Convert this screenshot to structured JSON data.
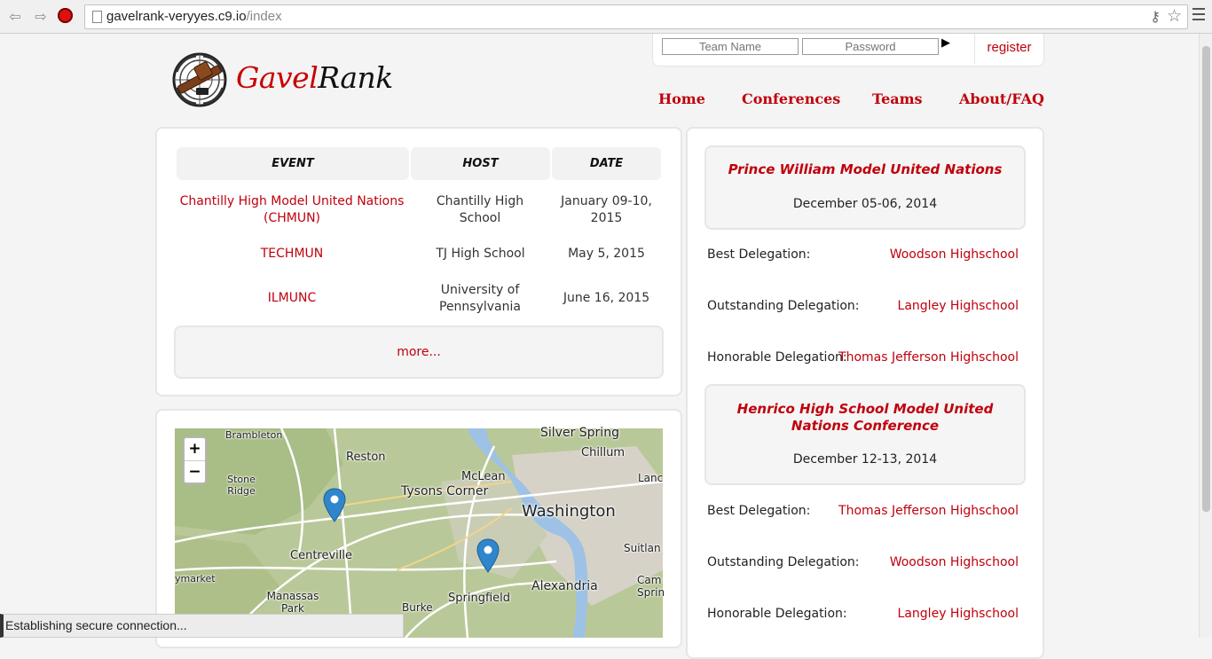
{
  "browser": {
    "url_host": "gavelrank-veryyes.c9.io",
    "url_path": "/index",
    "status_text": "Establishing secure connection..."
  },
  "site": {
    "logo_part1": "Gavel",
    "logo_part2": "Rank",
    "login": {
      "team_placeholder": "Team Name",
      "password_placeholder": "Password",
      "submit_icon": "play-arrow-icon",
      "register_label": "register"
    },
    "nav": [
      "Home",
      "Conferences",
      "Teams",
      "About/FAQ"
    ],
    "accent_color": "#c0000c"
  },
  "events_table": {
    "headers": [
      "EVENT",
      "HOST",
      "DATE"
    ],
    "rows": [
      {
        "event": "Chantilly High Model United Nations (CHMUN)",
        "host": "Chantilly High School",
        "date": "January 09-10, 2015"
      },
      {
        "event": "TECHMUN",
        "host": "TJ High School",
        "date": "May 5, 2015"
      },
      {
        "event": "ILMUNC",
        "host": "University of Pennsylvania",
        "date": "June 16, 2015"
      }
    ],
    "more_label": "more..."
  },
  "map": {
    "zoom_in": "+",
    "zoom_out": "−",
    "labels": [
      "Brambleton",
      "Reston",
      "Silver Spring",
      "Chillum",
      "Stone Ridge",
      "McLean",
      "Tysons Corner",
      "Lanc",
      "Washington",
      "Centreville",
      "Suitlan",
      "ymarket",
      "Alexandria",
      "Cam Sprin",
      "Manassas Park",
      "Burke",
      "Springfield"
    ],
    "markers": [
      "map-marker-icon",
      "map-marker-icon"
    ]
  },
  "results": [
    {
      "conference": "Prince William Model United Nations",
      "date": "December 05-06, 2014",
      "awards": [
        {
          "label": "Best Delegation:",
          "winner": "Woodson Highschool"
        },
        {
          "label": "Outstanding Delegation:",
          "winner": "Langley Highschool"
        },
        {
          "label": "Honorable Delegation:",
          "winner": "Thomas Jefferson Highschool"
        }
      ]
    },
    {
      "conference": "Henrico High School Model United Nations Conference",
      "date": "December 12-13, 2014",
      "awards": [
        {
          "label": "Best Delegation:",
          "winner": "Thomas Jefferson Highschool"
        },
        {
          "label": "Outstanding Delegation:",
          "winner": "Woodson Highschool"
        },
        {
          "label": "Honorable Delegation:",
          "winner": "Langley Highschool"
        }
      ]
    }
  ]
}
